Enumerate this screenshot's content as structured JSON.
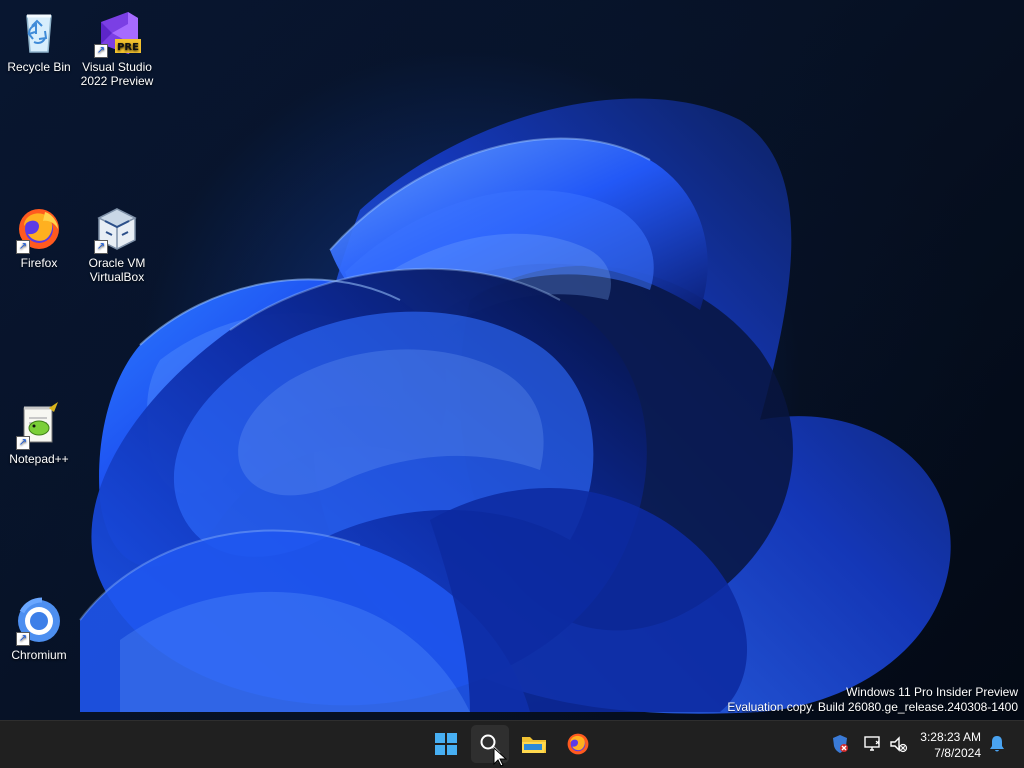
{
  "desktop": {
    "icons": [
      {
        "label": "Recycle Bin",
        "icon": "recycle-bin-icon"
      },
      {
        "label": "Visual Studio\n2022 Preview",
        "icon": "visual-studio-icon",
        "badge": "PRE"
      },
      {
        "label": "Firefox",
        "icon": "firefox-icon"
      },
      {
        "label": "Oracle VM\nVirtualBox",
        "icon": "virtualbox-icon"
      },
      {
        "label": "Notepad++",
        "icon": "notepad-plus-plus-icon"
      },
      {
        "label": "Chromium",
        "icon": "chromium-icon"
      }
    ],
    "watermark": {
      "line1": "Windows 11 Pro Insider Preview",
      "line2": "Evaluation copy. Build 26080.ge_release.240308-1400"
    }
  },
  "taskbar": {
    "pinned": [
      {
        "name": "start-button",
        "icon": "windows-logo-icon"
      },
      {
        "name": "search-button",
        "icon": "search-icon"
      },
      {
        "name": "file-explorer-button",
        "icon": "folder-icon"
      },
      {
        "name": "firefox-taskbar-button",
        "icon": "firefox-icon"
      }
    ],
    "tray": {
      "icons": [
        "security-shield-icon",
        "network-icon",
        "volume-muted-icon",
        "notification-bell-icon"
      ],
      "time": "3:28:23 AM",
      "date": "7/8/2024"
    }
  },
  "colors": {
    "taskbar_bg": "#202020",
    "desktop_bg": "#071326",
    "accent_blue": "#1f5fff",
    "start_blue": "#47aff3"
  }
}
